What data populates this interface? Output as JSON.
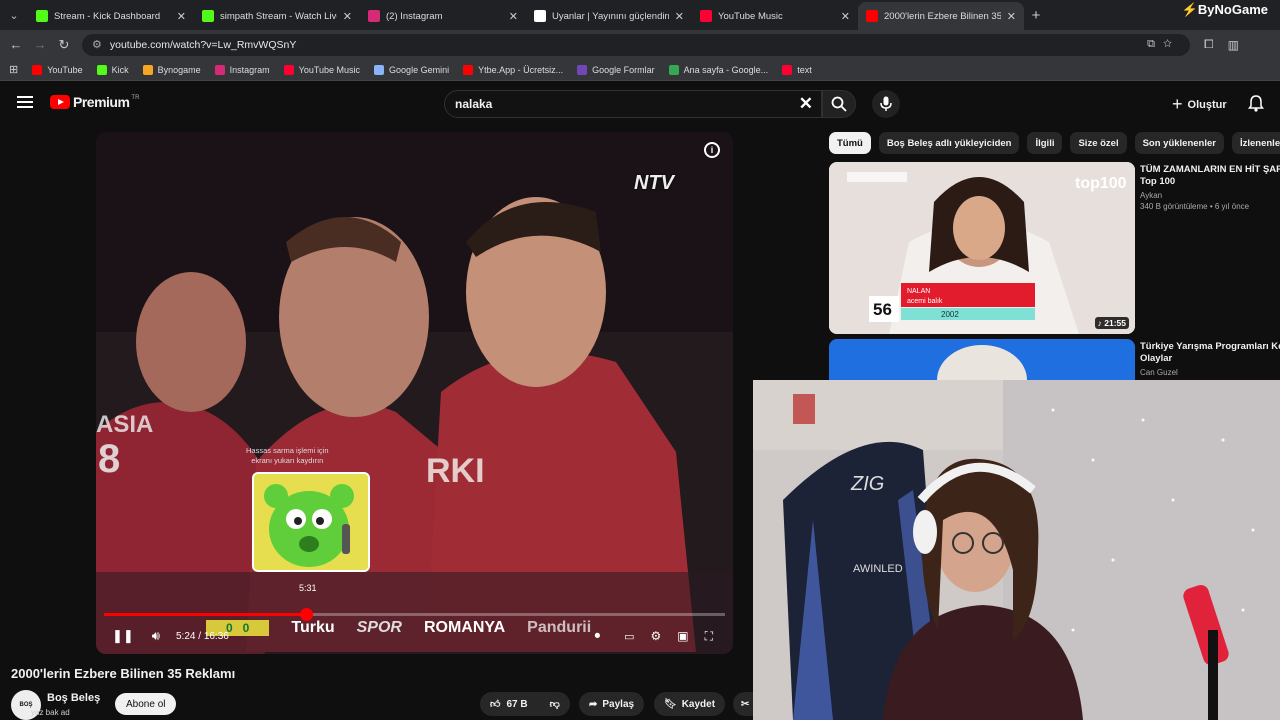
{
  "browser": {
    "tabs": [
      {
        "title": "Stream - Kick Dashboard",
        "favicon": "kick-icon",
        "color": "#53fc18",
        "active": false
      },
      {
        "title": "simpath Stream - Watch Live on",
        "favicon": "kick-icon",
        "color": "#53fc18",
        "active": false
      },
      {
        "title": "(2) Instagram",
        "favicon": "instagram-icon",
        "color": "#d62976",
        "active": false
      },
      {
        "title": "Uyanlar | Yayınını güçlendirmek",
        "favicon": "shield-icon",
        "color": "#ffffff",
        "active": false
      },
      {
        "title": "YouTube Music",
        "favicon": "youtube-music-icon",
        "color": "#ff0033",
        "active": false
      },
      {
        "title": "2000'lerin Ezbere Bilinen 35",
        "favicon": "youtube-icon",
        "color": "#ff0000",
        "active": true
      }
    ],
    "url": "youtube.com/watch?v=Lw_RmvWQSnY",
    "brand_overlay": "ByNoGame",
    "bookmarks": [
      {
        "label": "YouTube",
        "icon": "youtube-icon",
        "color": "#ff0000"
      },
      {
        "label": "Kick",
        "icon": "kick-icon",
        "color": "#53fc18"
      },
      {
        "label": "Bynogame",
        "icon": "bynogame-icon",
        "color": "#f5a623"
      },
      {
        "label": "Instagram",
        "icon": "instagram-icon",
        "color": "#d62976"
      },
      {
        "label": "YouTube Music",
        "icon": "youtube-music-icon",
        "color": "#ff0033"
      },
      {
        "label": "Google Gemini",
        "icon": "gemini-icon",
        "color": "#8ab4f8"
      },
      {
        "label": "Ytbe.App - Ücretsiz...",
        "icon": "ytbe-icon",
        "color": "#ff0000"
      },
      {
        "label": "Google Formlar",
        "icon": "forms-icon",
        "color": "#7248b9"
      },
      {
        "label": "Ana sayfa - Google...",
        "icon": "drive-icon",
        "color": "#34a853"
      },
      {
        "label": "text",
        "icon": "youtube-icon",
        "color": "#ff0033"
      }
    ]
  },
  "youtube": {
    "logo_text": "Premium",
    "logo_sup": "TR",
    "search_value": "nalaka",
    "create_label": "Oluştur",
    "accent": "#ff0000"
  },
  "player": {
    "watermark": "NTV",
    "hover_hint_line1": "Hassas sarma işlemi için",
    "hover_hint_line2": "ekranı yukarı kaydırın",
    "preview_time": "5:31",
    "current_time": "5:24",
    "duration": "16:36",
    "progress": 0.326,
    "ticker": [
      "Turku",
      "SPOR",
      "ROMANYA",
      "Pandurii"
    ]
  },
  "video": {
    "title": "2000'lerin Ezbere Bilinen 35 Reklamı",
    "channel": "Boş Beleş",
    "overlay_text": "yaz bak ad",
    "subscribe_label": "Abone ol",
    "likes": "67 B",
    "share_label": "Paylaş",
    "save_label": "Kaydet"
  },
  "chips": [
    "Tümü",
    "Boş Beleş adlı yükleyiciden",
    "İlgili",
    "Size özel",
    "Son yüklenenler",
    "İzlenenler"
  ],
  "recommendations": [
    {
      "title": "TÜM ZAMANLARIN EN HİT ŞARKI",
      "title2": "Top 100",
      "channel": "Aykan",
      "stats": "340 B görüntüleme • 6 yıl önce",
      "duration": "21:55",
      "thumb_badge": "top100",
      "rank": "56",
      "lower_name": "NALAN",
      "lower_song": "acemi balık",
      "lower_year": "2002"
    },
    {
      "title": "Türkiye Yarışma Programları Kor",
      "title2": "Olaylar",
      "channel": "Can Guzel"
    }
  ],
  "webcam": {
    "chair_brand": "ZIG",
    "chair_text": "AWINLED"
  }
}
